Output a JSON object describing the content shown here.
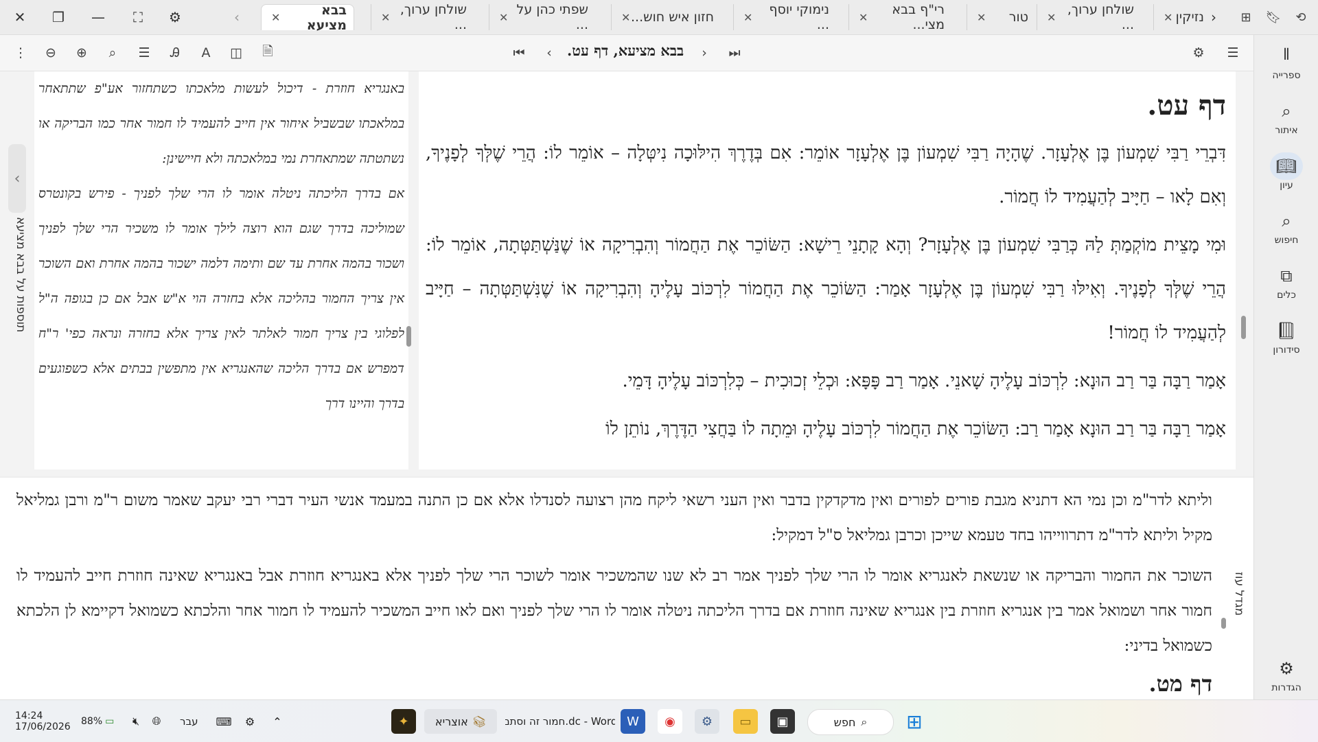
{
  "window": {
    "buttons": {
      "close": "✕",
      "restore": "❐",
      "minimize": "—",
      "fullscreen": "⛶",
      "settings": "⚙",
      "scroll_left": "‹",
      "scroll_right": "›"
    }
  },
  "tabs": [
    {
      "label": "בבא מציעא",
      "active": true
    },
    {
      "label": "שולחן ערוך, ...",
      "active": false
    },
    {
      "label": "שפתי כהן על ...",
      "active": false
    },
    {
      "label": "חזון איש חוש...",
      "active": false
    },
    {
      "label": "נימוקי יוסף ...",
      "active": false
    },
    {
      "label": "רי\"ף בבא מצי...",
      "active": false
    },
    {
      "label": "טור",
      "active": false
    },
    {
      "label": "שולחן ערוך, ...",
      "active": false
    },
    {
      "label": "נזיקין",
      "active": false
    }
  ],
  "toolbar": {
    "heading": "בבא מציעא, דף עט.",
    "first": "⏮",
    "prev": "‹",
    "next": "›",
    "last": "⏭"
  },
  "sidebar": {
    "items": [
      {
        "label": "ספרייה",
        "icon": "library-icon"
      },
      {
        "label": "איתור",
        "icon": "locate-icon"
      },
      {
        "label": "עיון",
        "icon": "book-open-icon",
        "active": true
      },
      {
        "label": "חיפוש",
        "icon": "search-icon"
      },
      {
        "label": "כלים",
        "icon": "tools-icon"
      },
      {
        "label": "סידורון",
        "icon": "siddur-icon"
      }
    ],
    "settings_label": "הגדרות"
  },
  "main": {
    "heading": "דף עט.",
    "paragraphs": [
      "דִּבְרֵי רַבִּי שִׁמְעוֹן בֶּן אֶלְעָזָר. שֶׁהָיָה רַבִּי שִׁמְעוֹן בֶּן אֶלְעָזָר אוֹמֵר: אִם בְּדֶרֶךְ הִילּוּכָה נִיטְּלָה – אוֹמֵר לוֹ: הֲרֵי שֶׁלְּךָ לְפָנֶיךָ, וְאִם לָאו – חַיָּיב לְהַעֲמִיד לוֹ חֲמוֹר.",
      "וּמִי מָצֵית מוֹקְמַתְּ לַהּ כְּרַבִּי שִׁמְעוֹן בֶּן אֶלְעָזָר? וְהָא קָתָנֵי רֵישָׁא: הַשּׂוֹכֵר אֶת הַחֲמוֹר וְהִבְרִיקָה אוֹ שֶׁנַּשְׁתַּטְּתָה, אוֹמֵר לוֹ: הֲרֵי שֶׁלְּךָ לְפָנֶיךָ. וְאִילּוּ רַבִּי שִׁמְעוֹן בֶּן אֶלְעָזָר אָמַר: הַשּׂוֹכֵר אֶת הַחֲמוֹר לִרְכּוֹב עָלֶיהָ וְהִבְרִיקָה אוֹ שֶׁנִּשְׁתַּטְּתָה – חַיָּיב לְהַעֲמִיד לוֹ חֲמוֹר!",
      "אָמַר רַבָּה בַּר רַב הוּנָא: לִרְכּוֹב עָלֶיהָ שָׁאנֵי. אָמַר רַב פָּפָּא: וּכְלֵי זְכוּכִית – כְּלִרְכּוֹב עָלֶיהָ דָּמֵי.",
      "אָמַר רַבָּה בַּר רַב הוּנָא אָמַר רַב: הַשּׂוֹכֵר אֶת הַחֲמוֹר לִרְכּוֹב עָלֶיהָ וּמֵתָה לוֹ בַּחֲצִי הַדֶּרֶךְ, נוֹתֵן לוֹ"
    ]
  },
  "tosafot": {
    "label": "תוספות על בבא מציעא",
    "paragraphs": [
      "באנגריא חוזרת - דיכול לעשות מלאכתו כשתחזור אע\"פ שתתאחר במלאכתו שבשביל איחור אין חייב להעמיד לו חמור אחר כמו הבריקה או נשתטתה שמתאחרת נמי במלאכתה ולא חיישינן:",
      "אם בדרך הליכתה ניטלה אומר לו הרי שלך לפניך - פירש בקונטרס שמוליכה בדרך שגם הוא רוצה לילך אומר לו משכיר הרי שלך לפניך ושכור בהמה אחרת עד שם ותימה דלמה ישכור בהמה אחרת ואם השוכר אין צריך החמור בהליכה אלא בחזרה הוי א\"ש אבל אם כן בגופה ה\"ל לפלוגי בין צריך חמור לאלתר לאין צריך אלא בחזרה ונראה כפי' ר\"ח דמפרש אם בדרך הליכה שהאנגריא אין מתפשין בבתים אלא כשפוגעים בדרך והיינו דרך"
    ]
  },
  "bottom": {
    "label": "מגדל עוז",
    "paragraphs": [
      "וליתא לדר\"מ וכן נמי הא דתניא מגבת פורים לפורים ואין מדקדקין בדבר ואין העני רשאי ליקח מהן רצועה לסנדלו אלא אם כן התנה במעמד אנשי העיר דברי רבי יעקב שאמר משום ר\"מ ורבן גמליאל מקיל וליתא לדר\"מ דתרווייהו בחד טעמא שייכן וכרבן גמליאל ס\"ל דמקיל:",
      "השוכר את החמור והבריקה או שנשאת לאנגריא אומר לו הרי שלך לפניך אמר רב לא שנו שהמשכיר אומר לשוכר הרי שלך לפניך אלא באנגריא חוזרת אבל באנגריא שאינה חוזרת חייב להעמיד לו חמור אחר ושמואל אמר בין אנגריא חוזרת בין אנגריא שאינה חוזרת אם בדרך הליכתה ניטלה אומר לו הרי שלך לפניך ואם לאו חייב המשכיר להעמיד לו חמור אחר והלכתא כשמואל דקיימא לן הלכתא כשמואל בדיני:"
    ],
    "next_heading": "דף מט."
  },
  "taskbar": {
    "time": "14:24",
    "date": "17/06/2026",
    "battery": "88%",
    "language": "עבר",
    "search_label": "חפש",
    "word_window": "חמור זה וסתם.dc - Word",
    "otzaria_label": "אוצריא"
  }
}
